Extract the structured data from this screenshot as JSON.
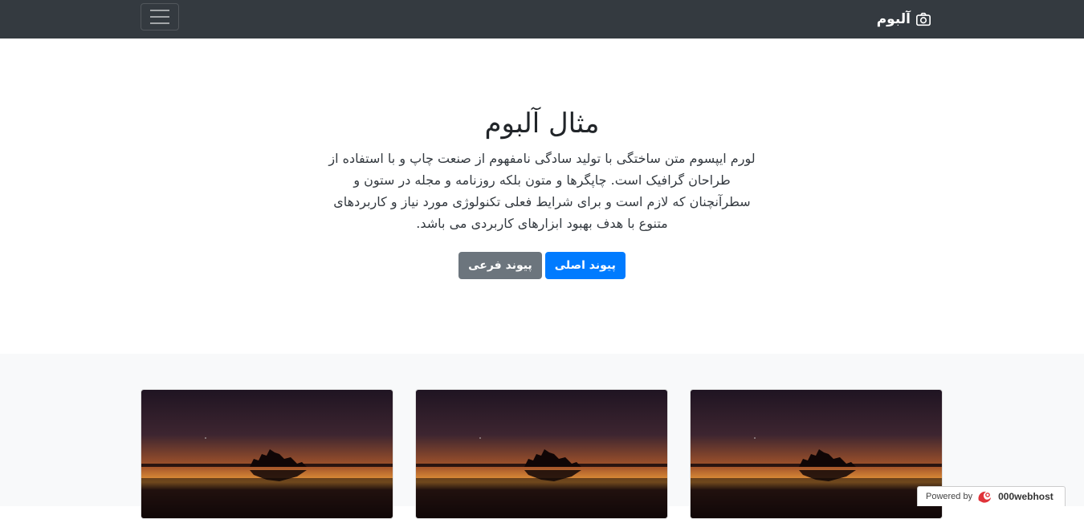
{
  "navbar": {
    "brand": "آلبوم",
    "brand_icon": "camera-icon",
    "toggle_icon": "menu-icon"
  },
  "hero": {
    "title": "مثال آلبوم",
    "lead": "لورم ایپسوم متن ساختگی با تولید سادگی نامفهوم از صنعت چاپ و با استفاده از طراحان گرافیک است. چاپگرها و متون بلکه روزنامه و مجله در ستون و سطرآنچنان که لازم است و برای شرایط فعلی تکنولوژی مورد نیاز و کاربردهای متنوع با هدف بهبود ابزارهای کاربردی می باشد.",
    "primary_button": "پیوند اصلی",
    "secondary_button": "پیوند فرعی"
  },
  "album": {
    "cards": [
      {
        "image": "sunset-silhouette-image"
      },
      {
        "image": "sunset-silhouette-image"
      },
      {
        "image": "sunset-silhouette-image"
      }
    ]
  },
  "footer_badge": {
    "powered_by": "Powered by",
    "brand": "000webhost"
  },
  "colors": {
    "navbar_bg": "#343a40",
    "primary": "#007bff",
    "secondary": "#6c757d",
    "album_bg": "#f8f9fa"
  }
}
